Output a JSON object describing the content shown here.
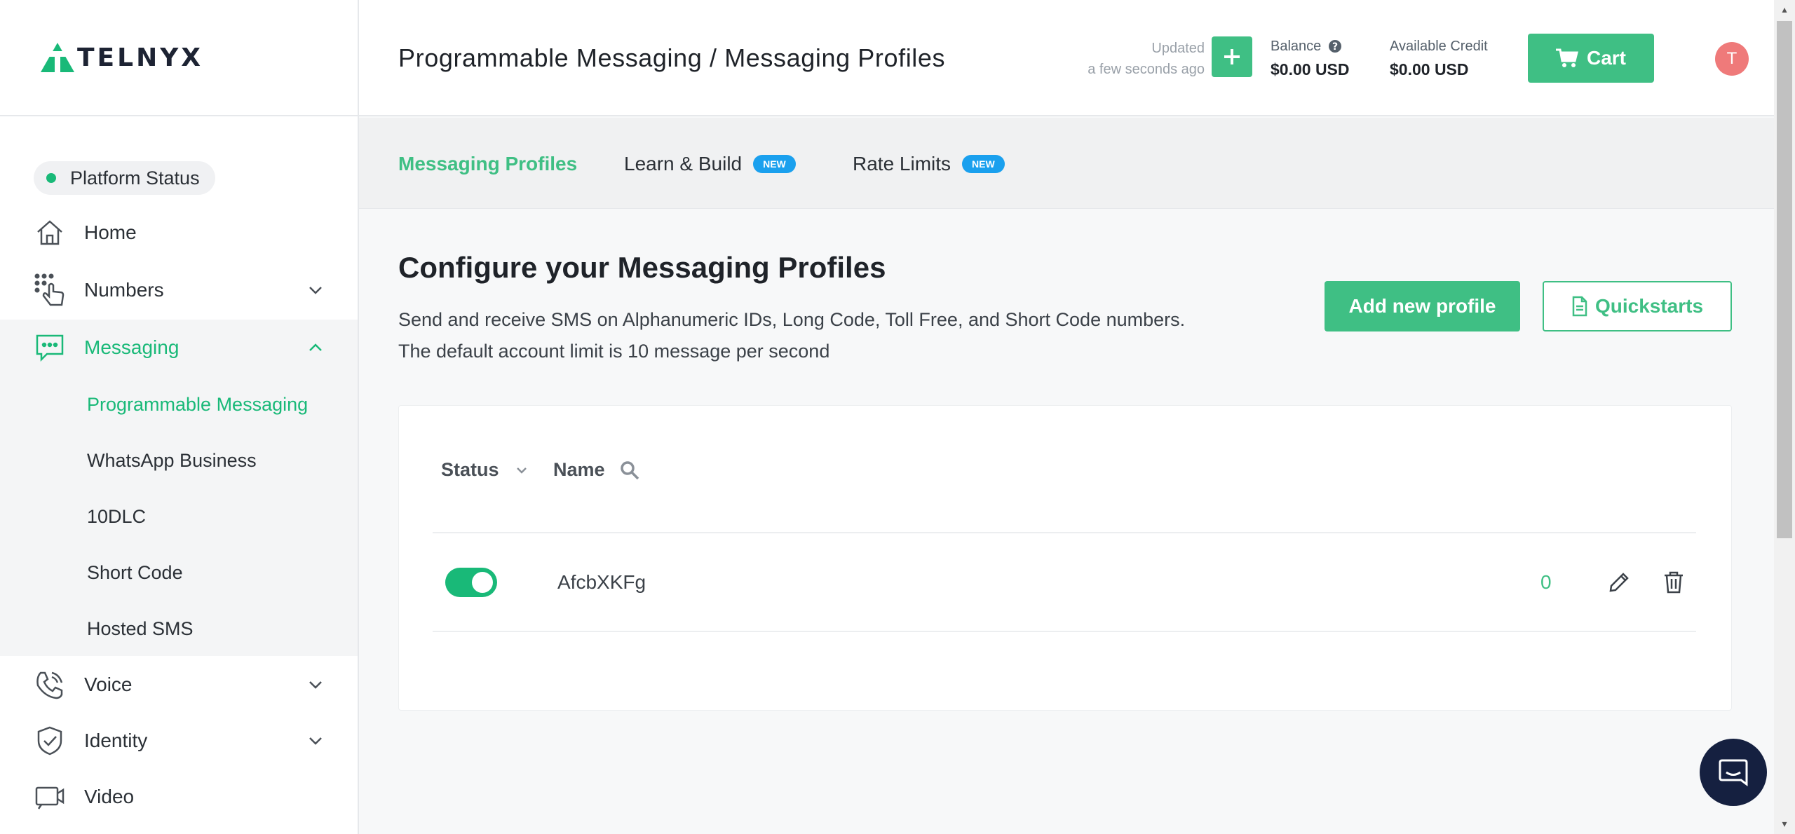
{
  "brand": {
    "name": "TELNYX",
    "accent": "#3fbf84",
    "status_green": "#19b978",
    "badge_blue": "#1aa0ee"
  },
  "sidebar": {
    "platform_status": "Platform Status",
    "items": [
      {
        "label": "Home",
        "icon": "home-icon"
      },
      {
        "label": "Numbers",
        "icon": "numbers-icon"
      },
      {
        "label": "Messaging",
        "icon": "messaging-icon"
      },
      {
        "label": "Voice",
        "icon": "voice-icon"
      },
      {
        "label": "Identity",
        "icon": "identity-icon"
      },
      {
        "label": "Video",
        "icon": "video-icon"
      }
    ],
    "messaging_sub": [
      {
        "label": "Programmable Messaging"
      },
      {
        "label": "WhatsApp Business"
      },
      {
        "label": "10DLC"
      },
      {
        "label": "Short Code"
      },
      {
        "label": "Hosted SMS"
      }
    ]
  },
  "header": {
    "title": "Programmable Messaging / Messaging Profiles",
    "updated_label": "Updated",
    "updated_time": "a few seconds ago",
    "balance_label": "Balance",
    "balance_value": "$0.00 USD",
    "credit_label": "Available Credit",
    "credit_value": "$0.00 USD",
    "cart_label": "Cart",
    "avatar_initial": "T"
  },
  "tabs": [
    {
      "label": "Messaging Profiles",
      "badge": ""
    },
    {
      "label": "Learn & Build",
      "badge": "NEW"
    },
    {
      "label": "Rate Limits",
      "badge": "NEW"
    }
  ],
  "main": {
    "title": "Configure your Messaging Profiles",
    "description_line1": "Send and receive SMS on Alphanumeric IDs, Long Code, Toll Free, and Short Code numbers.",
    "description_line2": "The default account limit is 10 message per second",
    "add_button": "Add new profile",
    "quickstarts_button": "Quickstarts"
  },
  "table": {
    "columns": {
      "status": "Status",
      "name": "Name"
    },
    "rows": [
      {
        "enabled": true,
        "name": "AfcbXKFg",
        "count": "0"
      }
    ]
  }
}
